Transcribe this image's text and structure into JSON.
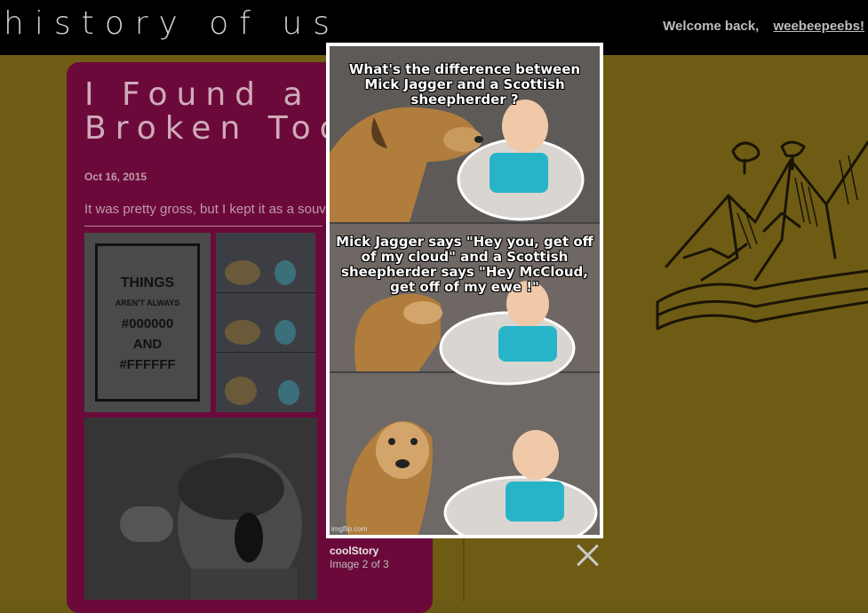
{
  "header": {
    "site_title": "history of us",
    "welcome_text": "Welcome back,",
    "username": "weebeepeebs!"
  },
  "post": {
    "title": "I Found a\nBroken Toot",
    "date": "Oct 16, 2015",
    "text": "It was pretty gross, but I kept it as a souv",
    "things_lines": [
      "THINGS",
      "AREN'T ALWAYS",
      "#000000",
      "AND",
      "#FFFFFF"
    ]
  },
  "lightbox": {
    "meme_top": "What's the difference between Mick Jagger and a Scottish sheepherder ?",
    "meme_middle": "Mick Jagger says \"Hey you, get off of my cloud\"    and a Scottish  sheepherder says \"Hey McCloud, get off of my ewe !\"",
    "watermark": "imgflip.com",
    "caption_title": "coolStory",
    "caption_count": "Image 2 of 3"
  },
  "colors": {
    "background": "#6e5c14",
    "card": "#6b0a3a",
    "topbar": "#000000"
  }
}
